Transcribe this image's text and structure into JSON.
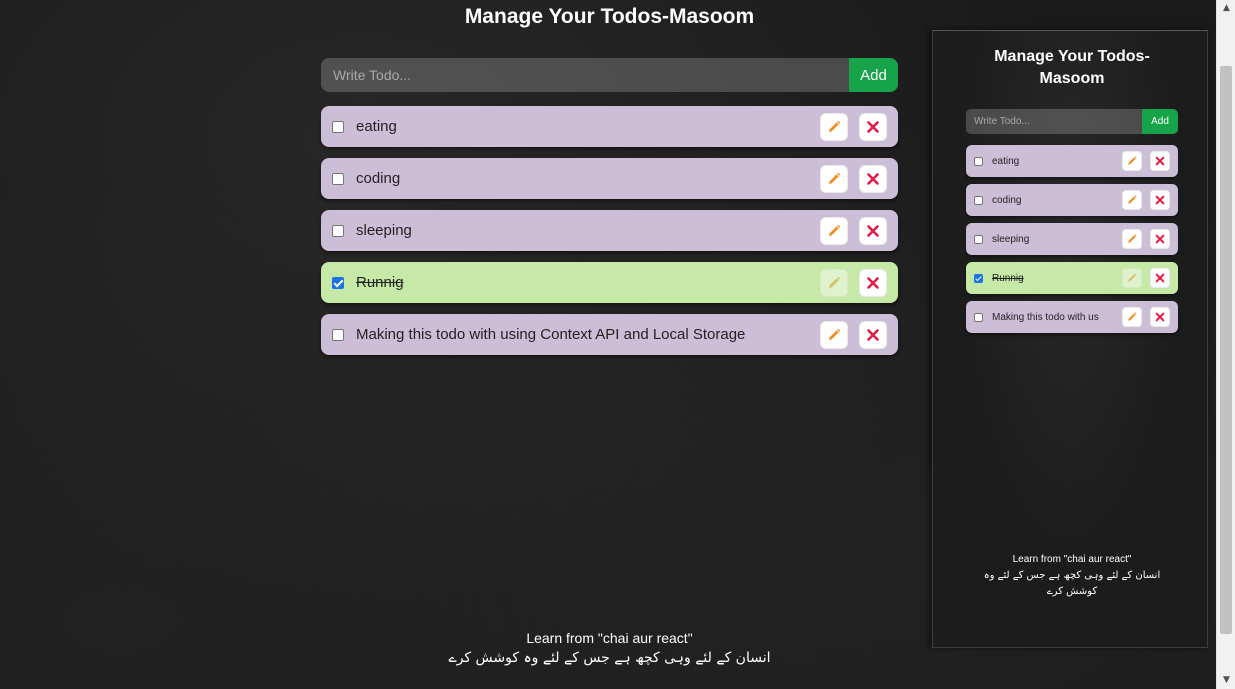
{
  "main": {
    "title": "Manage Your Todos-Masoom",
    "input_placeholder": "Write Todo...",
    "add_label": "Add",
    "todos": [
      {
        "text": "eating",
        "completed": false
      },
      {
        "text": "coding",
        "completed": false
      },
      {
        "text": "sleeping",
        "completed": false
      },
      {
        "text": "Runnig",
        "completed": true
      },
      {
        "text": "Making this todo with using Context API and Local Storage",
        "completed": false
      }
    ],
    "footer_line1": "Learn from \"chai aur react\"",
    "footer_line2": "انسان کے لئے وہی کچھ ہے جس کے لئے وہ کوشش کرے"
  },
  "preview": {
    "title": "Manage Your Todos-Masoom",
    "input_placeholder": "Write Todo...",
    "add_label": "Add",
    "todos": [
      {
        "text": "eating",
        "completed": false
      },
      {
        "text": "coding",
        "completed": false
      },
      {
        "text": "sleeping",
        "completed": false
      },
      {
        "text": "Runnig",
        "completed": true
      },
      {
        "text": "Making this todo with us",
        "completed": false
      }
    ],
    "footer_line1": "Learn from \"chai aur react\"",
    "footer_line2": "انسان کے لئے وہی کچھ ہے جس کے لئے وہ کوشش کرے"
  },
  "icons": {
    "edit": "pencil-icon",
    "delete": "close-icon"
  },
  "colors": {
    "todo_bg": "#ccbed7",
    "todo_done_bg": "#c6e9a7",
    "add_button": "#16a34a",
    "pencil": "#f28c1e",
    "close": "#e11d48"
  }
}
